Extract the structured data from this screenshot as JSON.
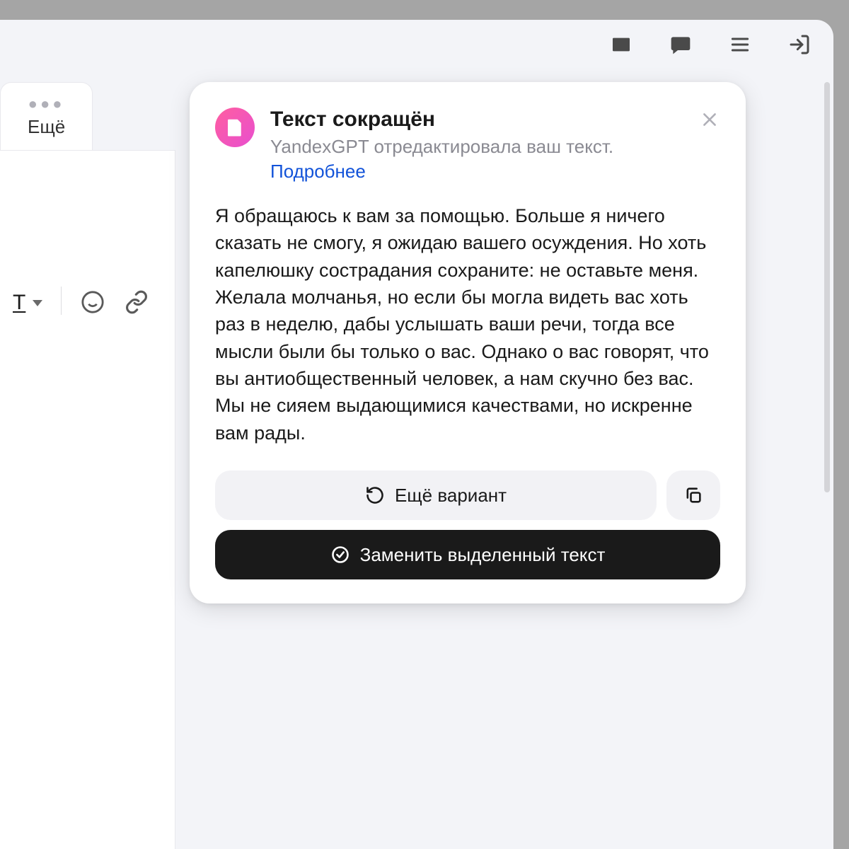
{
  "tabs": {
    "more_label": "Ещё"
  },
  "popup": {
    "title": "Текст сокращён",
    "subtitle": "YandexGPT отредактировала ваш текст.",
    "link_label": "Подробнее",
    "body": "Я обращаюсь к вам за помощью. Больше я ничего сказать не смогу, я ожидаю вашего осуждения. Но хоть капелюшку сострадания сохраните: не оставьте меня. Желала молчанья, но если бы могла видеть вас хоть раз в неделю, дабы услышать ваши речи, тогда все мысли были бы только о вас. Однако о вас говорят, что вы антиобщественный человек, а нам скучно без вас. Мы не сияем выдающимися качествами, но искренне вам рады.",
    "regenerate_label": "Ещё вариант",
    "replace_label": "Заменить выделенный текст"
  },
  "toolbar": {
    "text_format_label": "T"
  }
}
